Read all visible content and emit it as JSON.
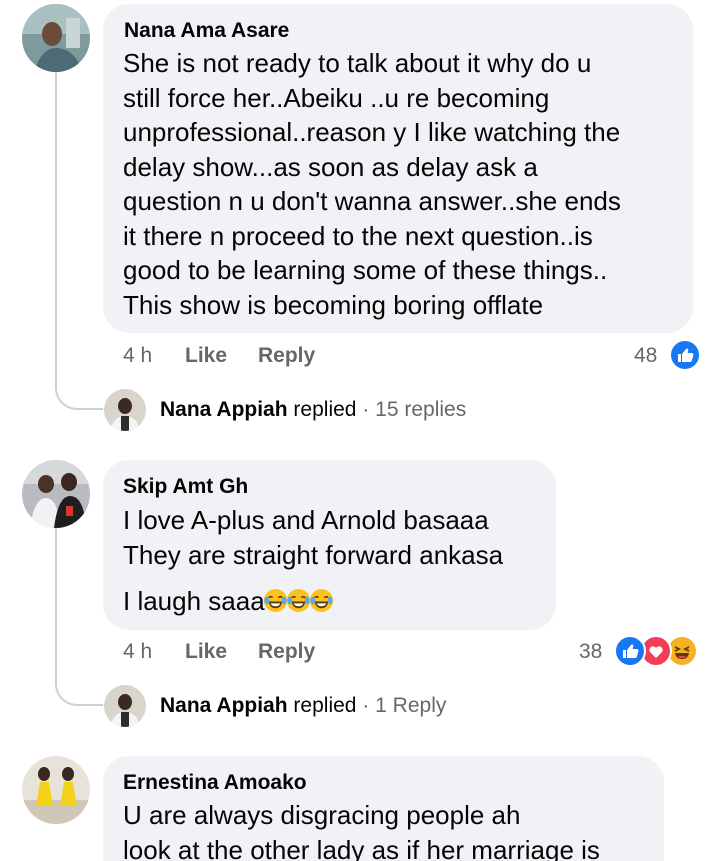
{
  "comments": [
    {
      "author": "Nana Ama Asare",
      "lines": [
        "She is not ready to talk about it why do u",
        "still force her..Abeiku ..u re becoming",
        "unprofessional..reason y I like watching the",
        "delay show...as soon as delay ask a",
        "question n u don't  wanna answer..she ends",
        "it there n proceed to the next question..is",
        "good to be learning some of these things..",
        "This show is becoming boring offlate"
      ],
      "time": "4 h",
      "like_label": "Like",
      "reply_label": "Reply",
      "reaction_count": "48",
      "reactions": [
        "like-icon"
      ],
      "replies_summary": {
        "name": "Nana Appiah",
        "verb": "replied",
        "separator": "·",
        "count": "15 replies"
      }
    },
    {
      "author": "Skip Amt Gh",
      "lines": [
        "I love A-plus and Arnold basaaa",
        "They are straight forward ankasa"
      ],
      "last_line_text": "I laugh saaa",
      "last_line_emojis": [
        "laugh-cry-emoji",
        "laugh-cry-emoji",
        "laugh-cry-emoji"
      ],
      "time": "4 h",
      "like_label": "Like",
      "reply_label": "Reply",
      "reaction_count": "38",
      "reactions": [
        "like-icon",
        "love-icon",
        "haha-icon"
      ],
      "replies_summary": {
        "name": "Nana Appiah",
        "verb": "replied",
        "separator": "·",
        "count": "1 Reply"
      }
    },
    {
      "author": "Ernestina Amoako",
      "lines": [
        "U are always disgracing people ah",
        "look at the other lady as if her marriage is"
      ]
    }
  ],
  "colors": {
    "bubble": "#f0f2f5",
    "secondary_text": "#65676b",
    "like_blue": "#1877f2",
    "love_red": "#f33e58",
    "haha_yellow": "#f7b125",
    "thread_line": "#ced0d4"
  }
}
